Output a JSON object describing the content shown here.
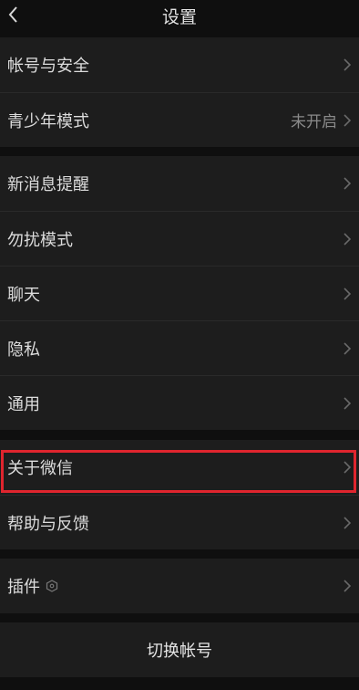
{
  "header": {
    "title": "设置",
    "back_icon": "chevron-left-icon"
  },
  "sections": {
    "account": [
      {
        "label": "帐号与安全",
        "value": ""
      },
      {
        "label": "青少年模式",
        "value": "未开启"
      }
    ],
    "general": [
      {
        "label": "新消息提醒"
      },
      {
        "label": "勿扰模式"
      },
      {
        "label": "聊天"
      },
      {
        "label": "隐私"
      },
      {
        "label": "通用"
      }
    ],
    "about": [
      {
        "label": "关于微信"
      },
      {
        "label": "帮助与反馈"
      }
    ],
    "plugins": [
      {
        "label": "插件",
        "icon": "plugin-hexagon-icon"
      }
    ]
  },
  "footer": {
    "switch_account": "切换帐号"
  },
  "colors": {
    "background": "#0f0f0f",
    "cell": "#1d1d1d",
    "highlight": "#e0252e"
  }
}
